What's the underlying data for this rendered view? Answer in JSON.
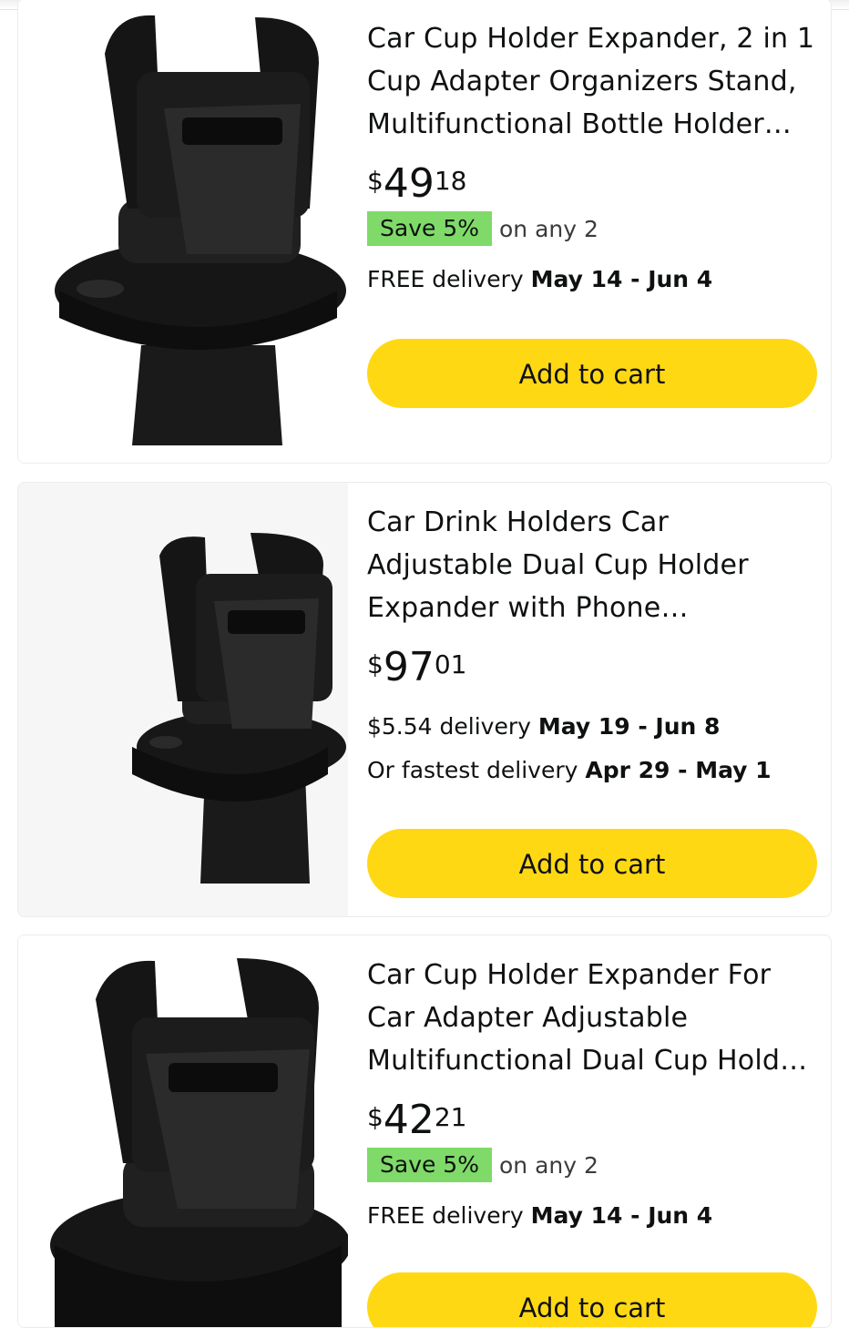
{
  "products": [
    {
      "title": "Car Cup Holder Expander, 2 in 1 Cup Adapter Organizers Stand, Multifunctional Bottle Holder…",
      "price_currency": "$",
      "price_whole": "49",
      "price_fraction": "18",
      "save_badge": "Save 5%",
      "save_note": "on any 2",
      "delivery_prefix": "FREE delivery ",
      "delivery_dates": "May 14 - Jun 4",
      "add_to_cart": "Add to cart"
    },
    {
      "title": "Car Drink Holders Car Adjustable Dual Cup Holder Expander with Phone Aromatherapy Organiz…",
      "price_currency": "$",
      "price_whole": "97",
      "price_fraction": "01",
      "delivery_prefix": "$5.54 delivery ",
      "delivery_dates": "May 19 - Jun 8",
      "fastest_prefix": "Or fastest delivery ",
      "fastest_dates": "Apr 29 - May 1",
      "add_to_cart": "Add to cart"
    },
    {
      "title": "Car Cup Holder Expander For Car Adapter Adjustable Multifunctional Dual Cup Hold…",
      "price_currency": "$",
      "price_whole": "42",
      "price_fraction": "21",
      "save_badge": "Save 5%",
      "save_note": "on any 2",
      "delivery_prefix": "FREE delivery ",
      "delivery_dates": "May 14 - Jun 4",
      "add_to_cart": "Add to cart"
    }
  ],
  "colors": {
    "cart_button": "#ffd814",
    "save_badge": "#7fda69"
  },
  "icons": [
    "product-image-cup-holder"
  ]
}
